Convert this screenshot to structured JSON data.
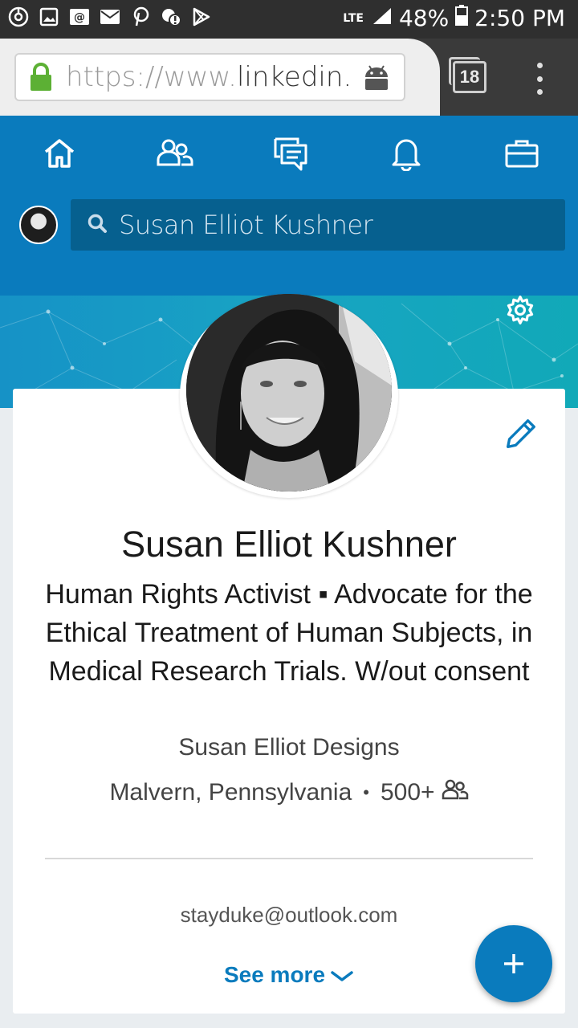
{
  "status_bar": {
    "network": "LTE",
    "battery": "48%",
    "time": "2:50 PM",
    "notification_icons": [
      "sync-icon",
      "image-icon",
      "at-sign-icon",
      "mail-icon",
      "pinterest-icon",
      "alert-icon",
      "play-store-icon"
    ]
  },
  "browser": {
    "url_prefix": "https://www.",
    "url_host": "linkedin.c",
    "tab_count": "18"
  },
  "nav": {
    "items": [
      "home-icon",
      "network-icon",
      "messaging-icon",
      "notifications-icon",
      "jobs-icon"
    ]
  },
  "search": {
    "value": "Susan Elliot Kushner"
  },
  "profile": {
    "name": "Susan Elliot Kushner",
    "headline": "Human Rights Activist ▪ Advocate for the Ethical Treatment of Human Subjects, in Medical Research Trials. W/out consent",
    "company": "Susan Elliot Designs",
    "location": "Malvern, Pennsylvania",
    "separator": "•",
    "connections": "500+",
    "email": "stayduke@outlook.com",
    "see_more": "See more"
  },
  "fab": {
    "symbol": "+"
  },
  "colors": {
    "linkedin_blue": "#0a7bbd",
    "search_bg": "#06608f",
    "status_bar": "#2f2f2f"
  }
}
